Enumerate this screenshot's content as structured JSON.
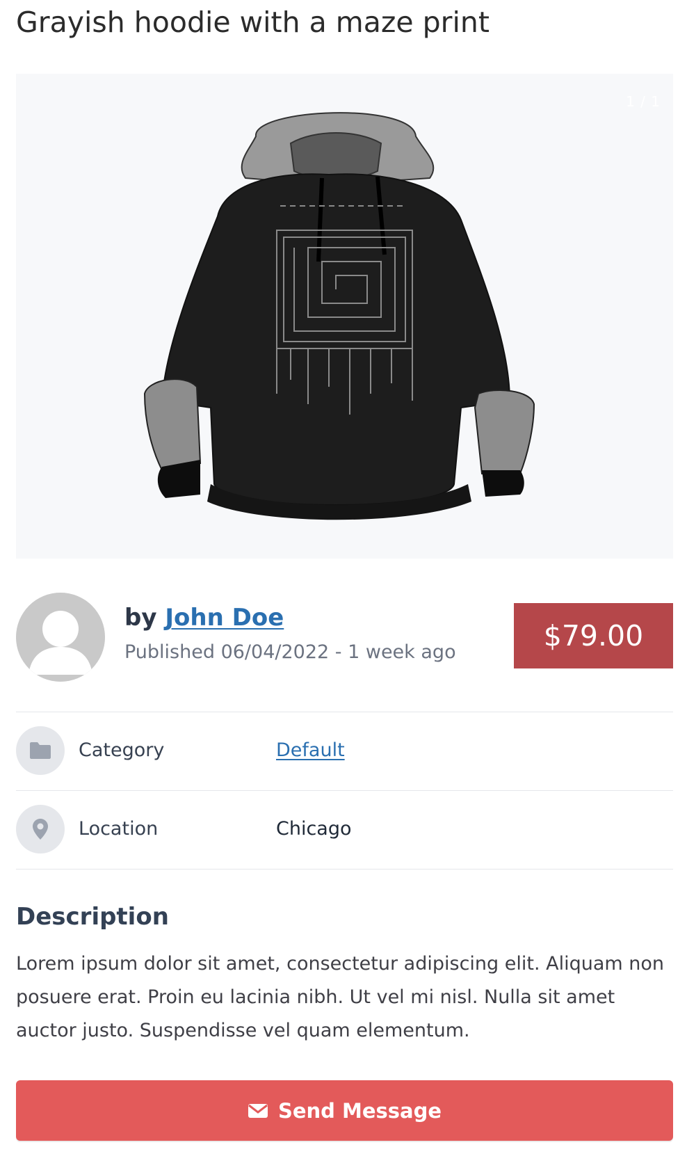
{
  "listing": {
    "title": "Grayish hoodie with a maze print",
    "gallery": {
      "image_alt": "Black hoodie with gray hood and sleeves and a maze print",
      "counter": "1 / 1"
    },
    "seller": {
      "by_prefix": "by",
      "name": "John Doe",
      "published": "Published 06/04/2022 - 1 week ago"
    },
    "price": "$79.00",
    "details": [
      {
        "label": "Category",
        "value": "Default",
        "icon": "folder-icon",
        "is_link": true
      },
      {
        "label": "Location",
        "value": "Chicago",
        "icon": "map-pin-icon",
        "is_link": false
      }
    ],
    "description": {
      "heading": "Description",
      "text": "Lorem ipsum dolor sit amet, consectetur adipiscing elit. Aliquam non posuere erat. Proin eu lacinia nibh. Ut vel mi nisl. Nulla sit amet auctor justo. Suspendisse vel quam elementum."
    },
    "send_button": {
      "label": "Send Message",
      "icon": "envelope-icon"
    }
  },
  "colors": {
    "price_bg": "#b5474a",
    "button_bg": "#e35a5a",
    "link": "#2a6fb0",
    "gallery_bg": "#f7f8fa",
    "divider": "#e5e7eb"
  }
}
